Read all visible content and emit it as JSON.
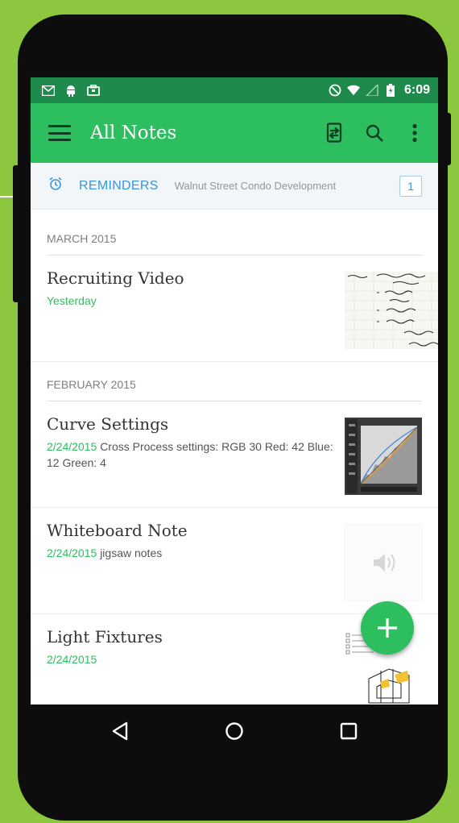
{
  "colors": {
    "background": "#8dc63f",
    "status_bar": "#1e8a4b",
    "app_bar": "#2dbe60",
    "accent_green": "#2dbe60",
    "reminder_blue": "#3796da"
  },
  "status_bar": {
    "left_icons": [
      "gmail-icon",
      "android-icon",
      "briefcase-icon"
    ],
    "right_icons": [
      "do-not-disturb-icon",
      "wifi-icon",
      "signal-icon",
      "battery-icon"
    ],
    "time": "6:09"
  },
  "app_bar": {
    "title": "All Notes",
    "icons": [
      "menu-icon",
      "sync-icon",
      "search-icon",
      "more-vert-icon"
    ]
  },
  "reminders": {
    "label": "REMINDERS",
    "preview": "Walnut Street Condo Development",
    "count": "1",
    "icon": "alarm-icon"
  },
  "sections": [
    {
      "header": "MARCH 2015",
      "notes": [
        {
          "title": "Recruiting Video",
          "date": "Yesterday",
          "snippet": ""
        }
      ]
    },
    {
      "header": "FEBRUARY 2015",
      "notes": [
        {
          "title": "Curve Settings",
          "date": "2/24/2015",
          "snippet": "Cross Process settings: RGB 30 Red: 42 Blue: 12 Green: 4"
        },
        {
          "title": "Whiteboard Note",
          "date": "2/24/2015",
          "snippet": "jigsaw notes"
        },
        {
          "title": "Light Fixtures",
          "date": "2/24/2015",
          "snippet": ""
        }
      ]
    }
  ],
  "fab": {
    "icon": "plus-icon"
  },
  "nav_bar": {
    "icons": [
      "back-icon",
      "home-icon",
      "recents-icon"
    ]
  }
}
